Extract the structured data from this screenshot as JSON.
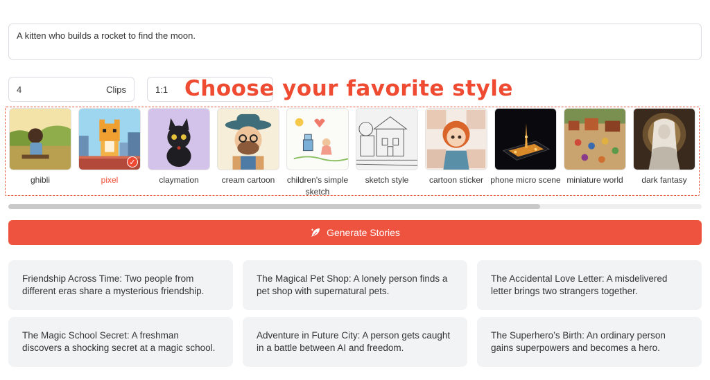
{
  "prompt": {
    "text": "A kitten who builds a rocket to find the moon."
  },
  "clips": {
    "value": "4",
    "unit": "Clips"
  },
  "ratio": {
    "value": "1:1"
  },
  "headline": "Choose your favorite style",
  "styles": [
    {
      "label": "ghibli",
      "selected": false
    },
    {
      "label": "pixel",
      "selected": true
    },
    {
      "label": "claymation",
      "selected": false
    },
    {
      "label": "cream cartoon",
      "selected": false
    },
    {
      "label": "children's simple sketch",
      "selected": false
    },
    {
      "label": "sketch style",
      "selected": false
    },
    {
      "label": "cartoon sticker",
      "selected": false
    },
    {
      "label": "phone micro scene",
      "selected": false
    },
    {
      "label": "miniature world",
      "selected": false
    },
    {
      "label": "dark fantasy",
      "selected": false
    }
  ],
  "generate_button": {
    "label": "Generate Stories",
    "icon": "feather-sparkle-icon"
  },
  "story_ideas": [
    "Friendship Across Time: Two people from different eras share a mysterious friendship.",
    "The Magical Pet Shop: A lonely person finds a pet shop with supernatural pets.",
    "The Accidental Love Letter: A misdelivered letter brings two strangers together.",
    "The Magic School Secret: A freshman discovers a shocking secret at a magic school.",
    "Adventure in Future City: A person gets caught in a battle between AI and freedom.",
    "The Superhero’s Birth: An ordinary person gains superpowers and becomes a hero."
  ],
  "colors": {
    "accent": "#ee5340",
    "card_bg": "#f2f3f5"
  }
}
